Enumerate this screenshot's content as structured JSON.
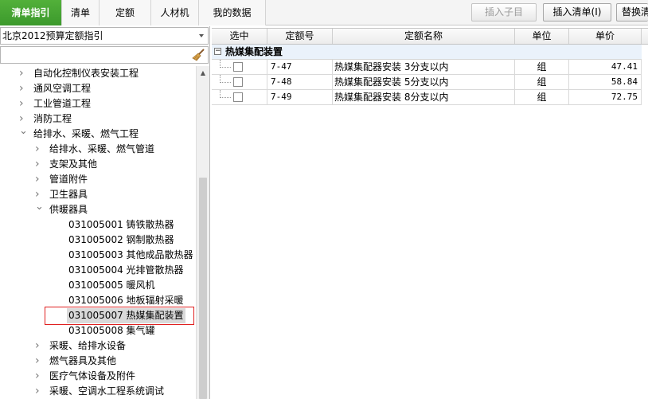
{
  "tabs": [
    {
      "label": "清单指引",
      "active": true
    },
    {
      "label": "清单"
    },
    {
      "label": "定额"
    },
    {
      "label": "人材机"
    },
    {
      "label": "我的数据"
    }
  ],
  "toolbar": {
    "insert_child": "插入子目",
    "insert_list": "插入清单(I)",
    "replace": "替换清"
  },
  "left_panel": {
    "library_select": "北京2012预算定额指引",
    "search_value": "",
    "tree": [
      {
        "label": "自动化控制仪表安装工程",
        "state": "collapsed",
        "level": 0
      },
      {
        "label": "通风空调工程",
        "state": "collapsed",
        "level": 0
      },
      {
        "label": "工业管道工程",
        "state": "collapsed",
        "level": 0
      },
      {
        "label": "消防工程",
        "state": "collapsed",
        "level": 0
      },
      {
        "label": "给排水、采暖、燃气工程",
        "state": "expanded",
        "level": 0
      },
      {
        "label": "给排水、采暖、燃气管道",
        "state": "collapsed",
        "level": 1
      },
      {
        "label": "支架及其他",
        "state": "collapsed",
        "level": 1
      },
      {
        "label": "管道附件",
        "state": "collapsed",
        "level": 1
      },
      {
        "label": "卫生器具",
        "state": "collapsed",
        "level": 1
      },
      {
        "label": "供暖器具",
        "state": "expanded",
        "level": 1
      },
      {
        "label": "031005001  铸铁散热器",
        "state": "leaf",
        "level": 2
      },
      {
        "label": "031005002  钢制散热器",
        "state": "leaf",
        "level": 2
      },
      {
        "label": "031005003  其他成品散热器",
        "state": "leaf",
        "level": 2
      },
      {
        "label": "031005004  光排管散热器",
        "state": "leaf",
        "level": 2
      },
      {
        "label": "031005005  暖风机",
        "state": "leaf",
        "level": 2
      },
      {
        "label": "031005006  地板辐射采暖",
        "state": "leaf",
        "level": 2
      },
      {
        "label": "031005007  热媒集配装置",
        "state": "leaf",
        "level": 2,
        "selected": true
      },
      {
        "label": "031005008  集气罐",
        "state": "leaf",
        "level": 2
      },
      {
        "label": "采暖、给排水设备",
        "state": "collapsed",
        "level": 1
      },
      {
        "label": "燃气器具及其他",
        "state": "collapsed",
        "level": 1
      },
      {
        "label": "医疗气体设备及附件",
        "state": "collapsed",
        "level": 1
      },
      {
        "label": "采暖、空调水工程系统调试",
        "state": "collapsed",
        "level": 1
      }
    ]
  },
  "grid": {
    "columns": [
      "选中",
      "定额号",
      "定额名称",
      "单位",
      "单价"
    ],
    "group_label": "热媒集配装置",
    "rows": [
      {
        "checked": false,
        "code": "7-47",
        "name": "热媒集配器安装 3分支以内",
        "unit": "组",
        "price": "47.41"
      },
      {
        "checked": false,
        "code": "7-48",
        "name": "热媒集配器安装 5分支以内",
        "unit": "组",
        "price": "58.84"
      },
      {
        "checked": false,
        "code": "7-49",
        "name": "热媒集配器安装 8分支以内",
        "unit": "组",
        "price": "72.75"
      }
    ]
  },
  "colors": {
    "active_tab": "#3c9a2c",
    "selection_outline": "#e02020",
    "group_row": "#eaf2fb"
  }
}
